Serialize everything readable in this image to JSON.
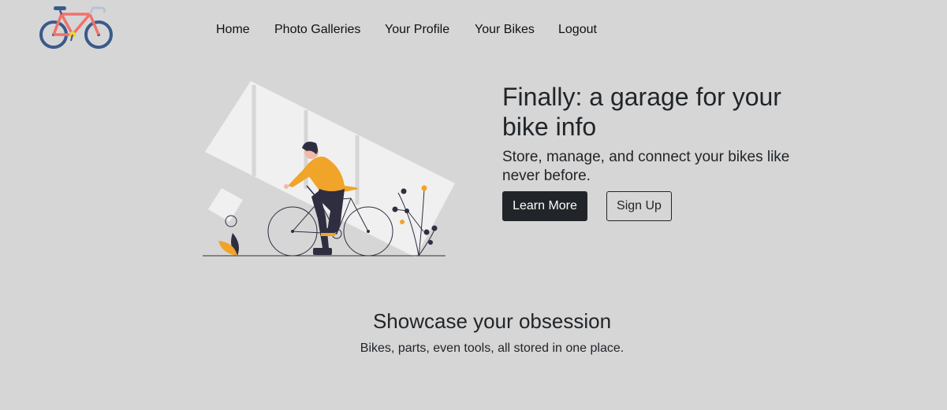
{
  "nav": {
    "items": [
      {
        "label": "Home"
      },
      {
        "label": "Photo Galleries"
      },
      {
        "label": "Your Profile"
      },
      {
        "label": "Your Bikes"
      },
      {
        "label": "Logout"
      }
    ]
  },
  "hero": {
    "title": "Finally: a garage for your bike info",
    "subtitle": "Store, manage, and connect your bikes like never before.",
    "learn_more_label": "Learn More",
    "sign_up_label": "Sign Up"
  },
  "showcase": {
    "title": "Showcase your obsession",
    "subtitle": "Bikes, parts, even tools, all stored in one place."
  },
  "colors": {
    "background": "#d6d6d6",
    "text": "#212529",
    "accent_orange": "#f0a429",
    "dark": "#2f2e41",
    "bike_frame": "#f0726a",
    "bike_wheel": "#3a5a8c"
  },
  "icons": {
    "logo": "bicycle-logo-icon",
    "illustration": "cyclist-illustration"
  }
}
